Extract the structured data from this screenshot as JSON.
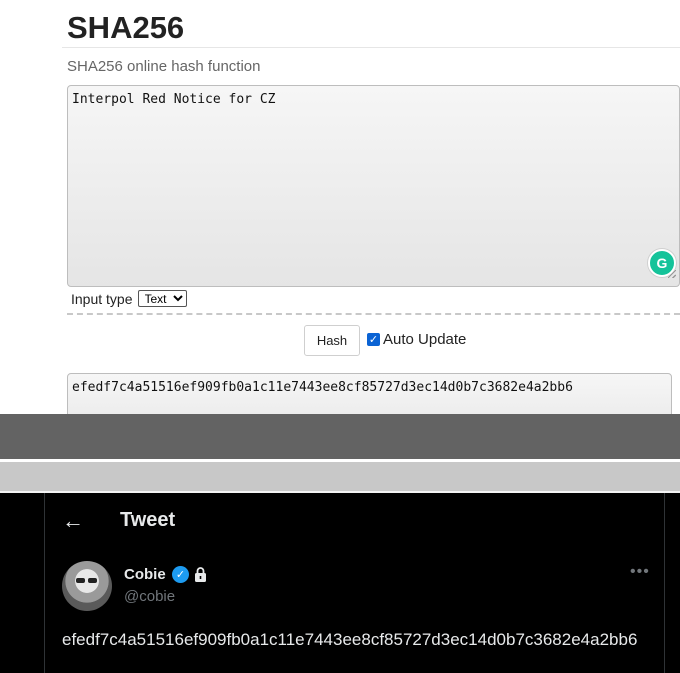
{
  "sha_tool": {
    "title": "SHA256",
    "subtitle": "SHA256 online hash function",
    "input_text": "Interpol Red Notice for CZ",
    "input_type_label": "Input type",
    "input_type_selected": "Text",
    "hash_button_label": "Hash",
    "auto_update_label": "Auto Update",
    "auto_update_checked": true,
    "output_hash": "efedf7c4a51516ef909fb0a1c11e7443ee8cf85727d3ec14d0b7c3682e4a2bb6",
    "grammarly_icon": "grammarly-icon"
  },
  "tweet": {
    "back_icon": "arrow-left-icon",
    "heading": "Tweet",
    "display_name": "Cobie",
    "handle": "@cobie",
    "verified_icon": "verified-badge-icon",
    "lock_icon": "lock-icon",
    "more_icon": "more-dots-icon",
    "text": "efedf7c4a51516ef909fb0a1c11e7443ee8cf85727d3ec14d0b7c3682e4a2bb6"
  },
  "colors": {
    "tweet_background": "#000000",
    "verified_blue": "#1d9bf0",
    "checkbox_blue": "#0b63d4",
    "divider_dark": "#636363",
    "divider_light": "#c8c8c8"
  }
}
